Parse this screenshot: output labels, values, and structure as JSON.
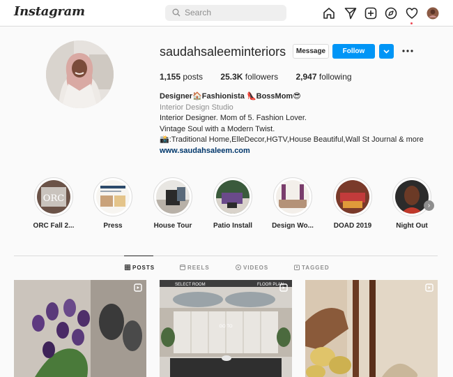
{
  "header": {
    "logo": "Instagram",
    "search_placeholder": "Search",
    "icons": [
      "home-icon",
      "direct-icon",
      "new-post-icon",
      "explore-icon",
      "activity-heart-icon",
      "profile-avatar"
    ]
  },
  "profile": {
    "username": "saudahsaleeminteriors",
    "message_label": "Message",
    "follow_label": "Follow",
    "stats": {
      "posts_count": "1,155",
      "posts_label": "posts",
      "followers_count": "25.3K",
      "followers_label": "followers",
      "following_count": "2,947",
      "following_label": "following"
    },
    "bio": {
      "name": "Designer🏠Fashionista 👠BossMom😎",
      "category": "Interior Design Studio",
      "line1": "Interior Designer. Mom of 5. Fashion Lover.",
      "line2": "Vintage Soul with a Modern Twist.",
      "line3": "📸:Traditional Home,ElleDecor,HGTV,House Beautiful,Wall St Journal & more",
      "website": "www.saudahsaleem.com"
    }
  },
  "highlights": [
    {
      "label": "ORC Fall 2..."
    },
    {
      "label": "Press"
    },
    {
      "label": "House Tour"
    },
    {
      "label": "Patio Install"
    },
    {
      "label": "Design Wo..."
    },
    {
      "label": "DOAD 2019"
    },
    {
      "label": "Night Out"
    }
  ],
  "tabs": [
    {
      "label": "POSTS",
      "active": true
    },
    {
      "label": "REELS",
      "active": false
    },
    {
      "label": "VIDEOS",
      "active": false
    },
    {
      "label": "TAGGED",
      "active": false
    }
  ],
  "posts": [
    {
      "subject": "purple tulips in vase"
    },
    {
      "subject": "dining room with chandeliers"
    },
    {
      "subject": "brown taper candles with yellow flowers"
    }
  ],
  "post_overlays": {
    "select_room": "SELECT ROOM",
    "floor_plan": "FLOOR PLAN",
    "go_to": "GO TO"
  },
  "colors": {
    "accent": "#0095f6",
    "link": "#00376b",
    "notification": "#ed4956"
  }
}
